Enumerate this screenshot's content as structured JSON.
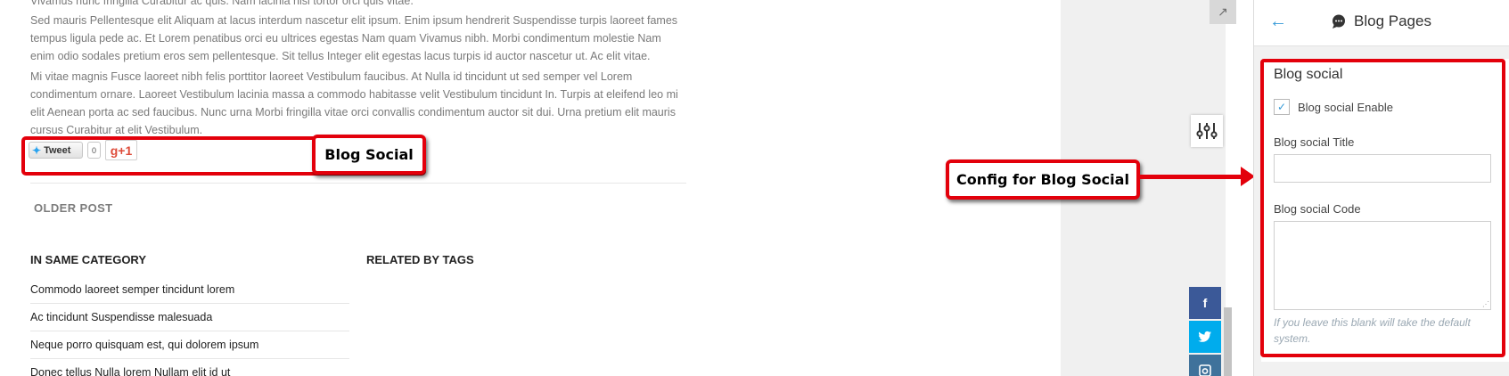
{
  "article": {
    "paragraphs": [
      "Vivamus nunc fringilla Curabitur ac quis. Nam lacinia nisi tortor orci quis vitae.",
      "Sed mauris Pellentesque elit Aliquam at lacus interdum nascetur elit ipsum. Enim ipsum hendrerit Suspendisse turpis laoreet fames tempus ligula pede ac. Et Lorem penatibus orci eu ultrices egestas Nam quam Vivamus nibh. Morbi condimentum molestie Nam enim odio sodales pretium eros sem pellentesque. Sit tellus Integer elit egestas lacus turpis id auctor nascetur ut. Ac elit vitae.",
      "Mi vitae magnis Fusce laoreet nibh felis porttitor laoreet Vestibulum faucibus. At Nulla id tincidunt ut sed semper vel Lorem condimentum ornare. Laoreet Vestibulum lacinia massa a commodo habitasse velit Vestibulum tincidunt In. Turpis at eleifend leo mi elit Aenean porta ac sed faucibus. Nunc urna Morbi fringilla vitae orci convallis condimentum auctor sit dui. Urna pretium elit mauris cursus Curabitur at elit Vestibulum."
    ],
    "social": {
      "tweet_label": "Tweet",
      "tweet_count": "0",
      "gplus_label": "g+1"
    },
    "older_post": "OLDER POST",
    "in_same_category": "IN SAME CATEGORY",
    "related_by_tags": "RELATED BY TAGS",
    "category_posts": [
      "Commodo laoreet semper tincidunt lorem",
      "Ac tincidunt Suspendisse malesuada",
      "Neque porro quisquam est, qui dolorem ipsum",
      "Donec tellus Nulla lorem Nullam elit id ut"
    ]
  },
  "annotations": {
    "blog_social": "Blog Social",
    "config_for_blog_social": "Config for Blog Social"
  },
  "panel": {
    "title": "Blog Pages",
    "section_title": "Blog social",
    "enable_label": "Blog social Enable",
    "enable_checked": true,
    "title_label": "Blog social Title",
    "title_value": "",
    "code_label": "Blog social Code",
    "code_value": "",
    "help_text": "If you leave this blank will take the default system."
  },
  "icons": {
    "back": "arrow-left-icon",
    "panel_title": "chat-bubble-icon",
    "expand": "expand-arrow-icon",
    "settings": "sliders-icon",
    "facebook": "facebook-icon",
    "twitter": "twitter-icon",
    "instagram": "instagram-icon"
  },
  "colors": {
    "annotation_red": "#e3000b",
    "accent_blue": "#3399d7",
    "facebook": "#3b5998",
    "twitter": "#00aced",
    "instagram": "#3f729b"
  }
}
